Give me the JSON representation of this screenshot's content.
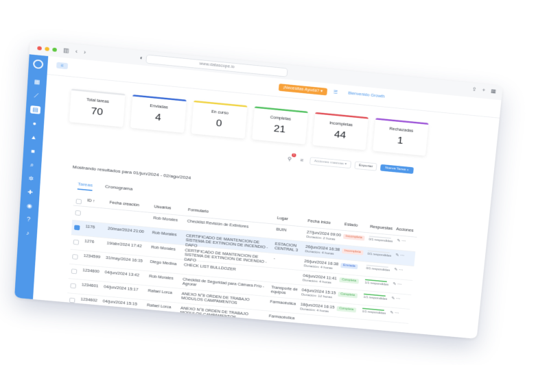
{
  "browser": {
    "url": "www.datascope.io"
  },
  "topbar": {
    "help_label": "¡Necesitas Ayuda?",
    "welcome": "Bienvenido Growth"
  },
  "stats": [
    {
      "label": "Total tareas",
      "value": "70",
      "color": ""
    },
    {
      "label": "Enviadas",
      "value": "4",
      "color": "#3f6fd8"
    },
    {
      "label": "En curso",
      "value": "0",
      "color": "#f1d54a"
    },
    {
      "label": "Completas",
      "value": "21",
      "color": "#59c467"
    },
    {
      "label": "Incompletas",
      "value": "44",
      "color": "#e3565d"
    },
    {
      "label": "Rechazadas",
      "value": "1",
      "color": "#a05ad9"
    }
  ],
  "toolbar": {
    "filter_badge": "1",
    "bulk_placeholder": "Acciones masivas",
    "export_label": "Exportar",
    "new_task_label": "Nueva Tarea"
  },
  "results_text": "Mostrando resultados para 01/jun/2024 - 02/ago/2024",
  "tabs": [
    "Tareas",
    "Cronograma"
  ],
  "table": {
    "headers": {
      "id": "ID",
      "fecha_creacion": "Fecha creación",
      "usuarios": "Usuarios",
      "formulario": "Formulario",
      "lugar": "Lugar",
      "fecha_inicio": "Fecha inicio",
      "estado": "Estado",
      "respuestas": "Respuestas",
      "acciones": "Acciones"
    },
    "rows": [
      {
        "id": "",
        "fecha": "",
        "usuario": "Rob Morales",
        "formulario": "Checklist Revisión de Extintores",
        "lugar": "BUIN",
        "inicio": "27/jun/2024 09:00",
        "duracion": "Duración: 2 horas",
        "estado": "Incompleta",
        "respuestas": "0/1 respondidas",
        "checked": false
      },
      {
        "id": "1176",
        "fecha": "20/mar/2024 21:00",
        "usuario": "Rob Morales",
        "formulario": "CERTIFICADO DE MANTENCION DE SISTEMA DE EXTINCION DE INCENDIO - DAFO",
        "lugar": "ESTACION CENTRAL 3",
        "inicio": "26/jun/2024 16:38",
        "duracion": "Duración: 4 horas",
        "estado": "Incompleta",
        "respuestas": "0/1 respondidas",
        "checked": true
      },
      {
        "id": "1276",
        "fecha": "19/abr/2024 17:42",
        "usuario": "Rob Morales",
        "formulario": "CERTIFICADO DE MANTENCION DE SISTEMA DE EXTINCION DE INCENDIO - DAFO",
        "lugar": "-",
        "inicio": "26/jun/2024 16:38",
        "duracion": "Duración: 4 horas",
        "estado": "Enviada",
        "respuestas": "0/1 respondidas",
        "checked": false
      },
      {
        "id": "1234599",
        "fecha": "31/may/2024 16:15",
        "usuario": "Diego Medina",
        "formulario": "CHECK LIST BULLDOZER",
        "lugar": "",
        "inicio": "04/jun/2024 11:41",
        "duracion": "Duración: 4 horas",
        "estado": "Completa",
        "respuestas": "1/1 respondidas",
        "checked": false
      },
      {
        "id": "1234600",
        "fecha": "04/jun/2024 13:42",
        "usuario": "Rob Morales",
        "formulario": "Checklist de Seguridad para Cámara Frío - Agrorar",
        "lugar": "Transporte de equipos",
        "inicio": "04/jun/2024 15:15",
        "duracion": "Duración: 12 horas",
        "estado": "Completa",
        "respuestas": "1/1 respondidas",
        "checked": false
      },
      {
        "id": "1234601",
        "fecha": "04/jun/2024 15:17",
        "usuario": "Rafael Lorca",
        "formulario": "ANEXO N°8 ORDEN DE TRABAJO MODULOS CAMPAMENTOS",
        "lugar": "Farmacéutica",
        "inicio": "18/jun/2024 16:15",
        "duracion": "Duración: 4 horas",
        "estado": "Completa",
        "respuestas": "1/1 respondidas",
        "checked": false
      },
      {
        "id": "1234602",
        "fecha": "04/jun/2024 15:15",
        "usuario": "Rafael Lorca",
        "formulario": "ANEXO N°8 ORDEN DE TRABAJO MODULOS CAMPAMENTOS",
        "lugar": "Farmacéutica",
        "inicio": "",
        "duracion": "",
        "estado": "",
        "respuestas": "",
        "checked": false
      }
    ]
  },
  "colors": {
    "accent": "#4f98ea",
    "incompleta_bg": "#fde6e3",
    "incompleta_fg": "#e06a4a",
    "enviada_bg": "#dde9fb",
    "enviada_fg": "#3f6fd8",
    "completa_bg": "#e2f5e4",
    "completa_fg": "#4bae58"
  }
}
